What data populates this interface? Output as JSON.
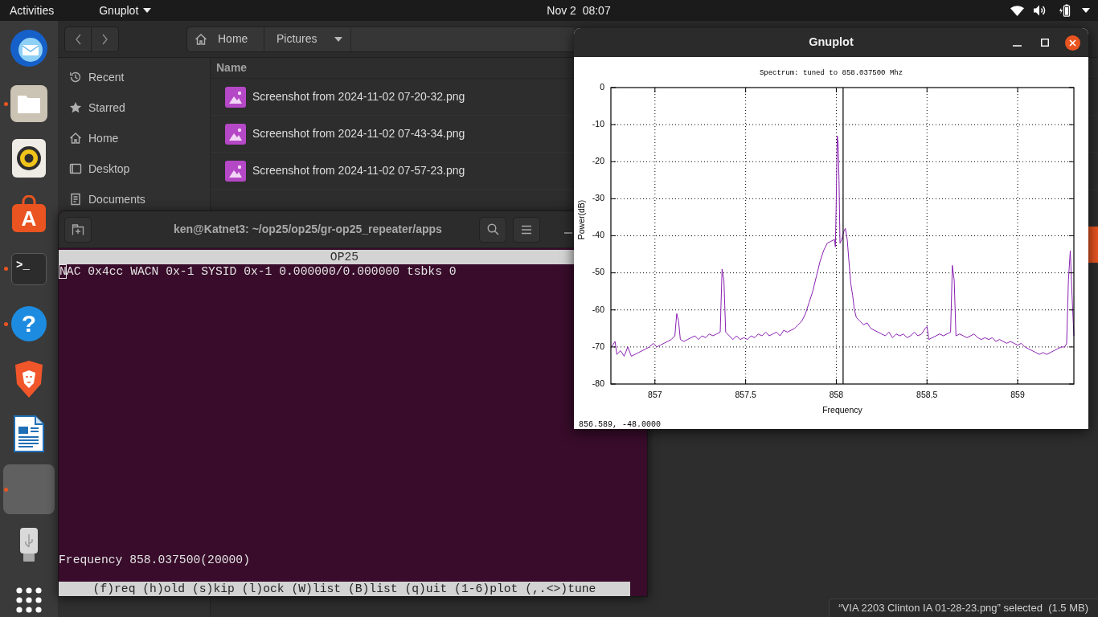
{
  "top_bar": {
    "activities": "Activities",
    "app_menu": "Gnuplot",
    "clock": "Nov 2  08:07"
  },
  "dock": {
    "items": [
      {
        "kind": "mail",
        "running": false,
        "selected": false
      },
      {
        "kind": "files",
        "running": true,
        "selected": false
      },
      {
        "kind": "music",
        "running": false,
        "selected": false
      },
      {
        "kind": "store",
        "glyph": "A",
        "running": false,
        "selected": false
      },
      {
        "kind": "terminal",
        "glyph": ">_",
        "running": true,
        "selected": false
      },
      {
        "kind": "help",
        "glyph": "?",
        "running": true,
        "selected": false
      },
      {
        "kind": "browser",
        "running": false,
        "selected": false
      },
      {
        "kind": "writer",
        "running": false,
        "selected": false
      },
      {
        "kind": "blank",
        "running": true,
        "selected": true
      },
      {
        "kind": "usb",
        "running": false,
        "selected": false
      }
    ]
  },
  "files": {
    "path": [
      {
        "kind": "home",
        "label": "Home"
      },
      {
        "kind": "current",
        "label": "Pictures"
      }
    ],
    "sidebar": [
      {
        "kind": "recent",
        "label": "Recent"
      },
      {
        "kind": "starred",
        "label": "Starred"
      },
      {
        "kind": "home",
        "label": "Home"
      },
      {
        "kind": "desktop",
        "label": "Desktop"
      },
      {
        "kind": "documents",
        "label": "Documents"
      }
    ],
    "column": "Name",
    "rows": [
      {
        "name": "Screenshot from 2024-11-02 07-20-32.png",
        "selected": false
      },
      {
        "name": "Screenshot from 2024-11-02 07-43-34.png",
        "selected": false
      },
      {
        "name": "Screenshot from 2024-11-02 07-57-23.png",
        "selected": false
      },
      {
        "selected": false
      },
      {
        "selected": true
      }
    ],
    "status": "“VIA 2203 Clinton IA 01-28-23.png” selected  (1.5 MB)"
  },
  "terminal": {
    "title": "ken@Katnet3: ~/op25/op25/gr-op25_repeater/apps",
    "screen_title": "OP25",
    "lines": [
      "NAC 0x4cc WACN 0x-1 SYSID 0x-1 0.000000/0.000000 tsbks 0"
    ],
    "frequency": "Frequency 858.037500(20000)",
    "key_help": "(f)req (h)old (s)kip (l)ock (W)list (B)list (q)uit (1-6)plot (,.<>)tune"
  },
  "gnuplot": {
    "title": "Gnuplot",
    "chart_data": {
      "type": "line",
      "title": "Spectrum: tuned to 858.037500 Mhz",
      "xlabel": "Frequency",
      "ylabel": "Power(dB)",
      "x": [
        856.76,
        856.78,
        856.79,
        856.81,
        856.83,
        856.85,
        856.87,
        856.89,
        856.91,
        856.93,
        856.95,
        856.97,
        856.99,
        857.01,
        857.03,
        857.05,
        857.07,
        857.09,
        857.11,
        857.12,
        857.13,
        857.14,
        857.16,
        857.18,
        857.2,
        857.22,
        857.24,
        857.26,
        857.28,
        857.3,
        857.32,
        857.34,
        857.36,
        857.37,
        857.38,
        857.39,
        857.41,
        857.43,
        857.45,
        857.47,
        857.49,
        857.51,
        857.53,
        857.55,
        857.57,
        857.59,
        857.61,
        857.63,
        857.65,
        857.67,
        857.69,
        857.71,
        857.73,
        857.75,
        857.77,
        857.79,
        857.81,
        857.83,
        857.85,
        857.87,
        857.89,
        857.91,
        857.93,
        857.95,
        857.97,
        857.99,
        857.995,
        858,
        858.005,
        858.01,
        858.015,
        858.02,
        858.03,
        858.04,
        858.05,
        858.06,
        858.07,
        858.08,
        858.09,
        858.1,
        858.11,
        858.13,
        858.15,
        858.17,
        858.19,
        858.21,
        858.23,
        858.25,
        858.27,
        858.29,
        858.31,
        858.33,
        858.35,
        858.37,
        858.39,
        858.41,
        858.43,
        858.45,
        858.47,
        858.49,
        858.5,
        858.51,
        858.53,
        858.55,
        858.57,
        858.59,
        858.61,
        858.63,
        858.64,
        858.65,
        858.66,
        858.68,
        858.7,
        858.72,
        858.74,
        858.76,
        858.78,
        858.8,
        858.82,
        858.84,
        858.86,
        858.88,
        858.9,
        858.92,
        858.94,
        858.96,
        858.98,
        859,
        859.02,
        859.04,
        859.06,
        859.08,
        859.1,
        859.12,
        859.14,
        859.16,
        859.18,
        859.2,
        859.22,
        859.24,
        859.26,
        859.27,
        859.28,
        859.29,
        859.3,
        859.31
      ],
      "values": [
        -70,
        -68.5,
        -72,
        -71,
        -72.5,
        -70,
        -72.5,
        -72,
        -71.5,
        -71,
        -70.5,
        -70,
        -69,
        -70,
        -69.5,
        -69,
        -68.5,
        -68,
        -67,
        -61,
        -63,
        -68,
        -68.5,
        -68,
        -67.5,
        -67,
        -68,
        -67,
        -67.5,
        -66.5,
        -67,
        -66.5,
        -66,
        -49,
        -52,
        -66,
        -67,
        -68,
        -67,
        -68,
        -67.5,
        -68,
        -67,
        -67.5,
        -66.5,
        -67,
        -66,
        -67,
        -66.5,
        -66,
        -67,
        -65.5,
        -66,
        -65.5,
        -65,
        -64,
        -63,
        -61,
        -58,
        -55,
        -51,
        -47,
        -44,
        -42,
        -41.5,
        -41,
        -43,
        -30,
        -13,
        -15,
        -25,
        -42,
        -41,
        -39,
        -38,
        -41,
        -47,
        -53,
        -56,
        -60,
        -62,
        -63,
        -64,
        -63.5,
        -65,
        -65.5,
        -66,
        -66.5,
        -67,
        -66,
        -67.5,
        -66.5,
        -67,
        -66.5,
        -67.5,
        -67,
        -66,
        -67,
        -66.5,
        -65,
        -64.5,
        -68,
        -67.5,
        -67,
        -66.5,
        -67,
        -66.5,
        -66,
        -48,
        -52,
        -67,
        -66.5,
        -67,
        -67.5,
        -67,
        -66.5,
        -67.5,
        -68,
        -67.5,
        -68,
        -67.5,
        -68.5,
        -68,
        -68.5,
        -69,
        -68.5,
        -69,
        -69.5,
        -69,
        -70,
        -70.5,
        -71,
        -71.5,
        -72,
        -71.5,
        -72,
        -71.5,
        -71,
        -70.5,
        -70,
        -70,
        -69,
        -52,
        -44,
        -56,
        -67
      ],
      "xlim": [
        856.757,
        859.31
      ],
      "ylim": [
        -80,
        0
      ],
      "xticks": [
        857,
        857.5,
        858,
        858.5,
        859
      ],
      "yticks": [
        0,
        -10,
        -20,
        -30,
        -40,
        -50,
        -60,
        -70,
        -80
      ],
      "grid": true,
      "ref_lines": [
        {
          "axis": "x",
          "value": 858.0375
        }
      ]
    },
    "status": "856.589, -48.0000"
  }
}
